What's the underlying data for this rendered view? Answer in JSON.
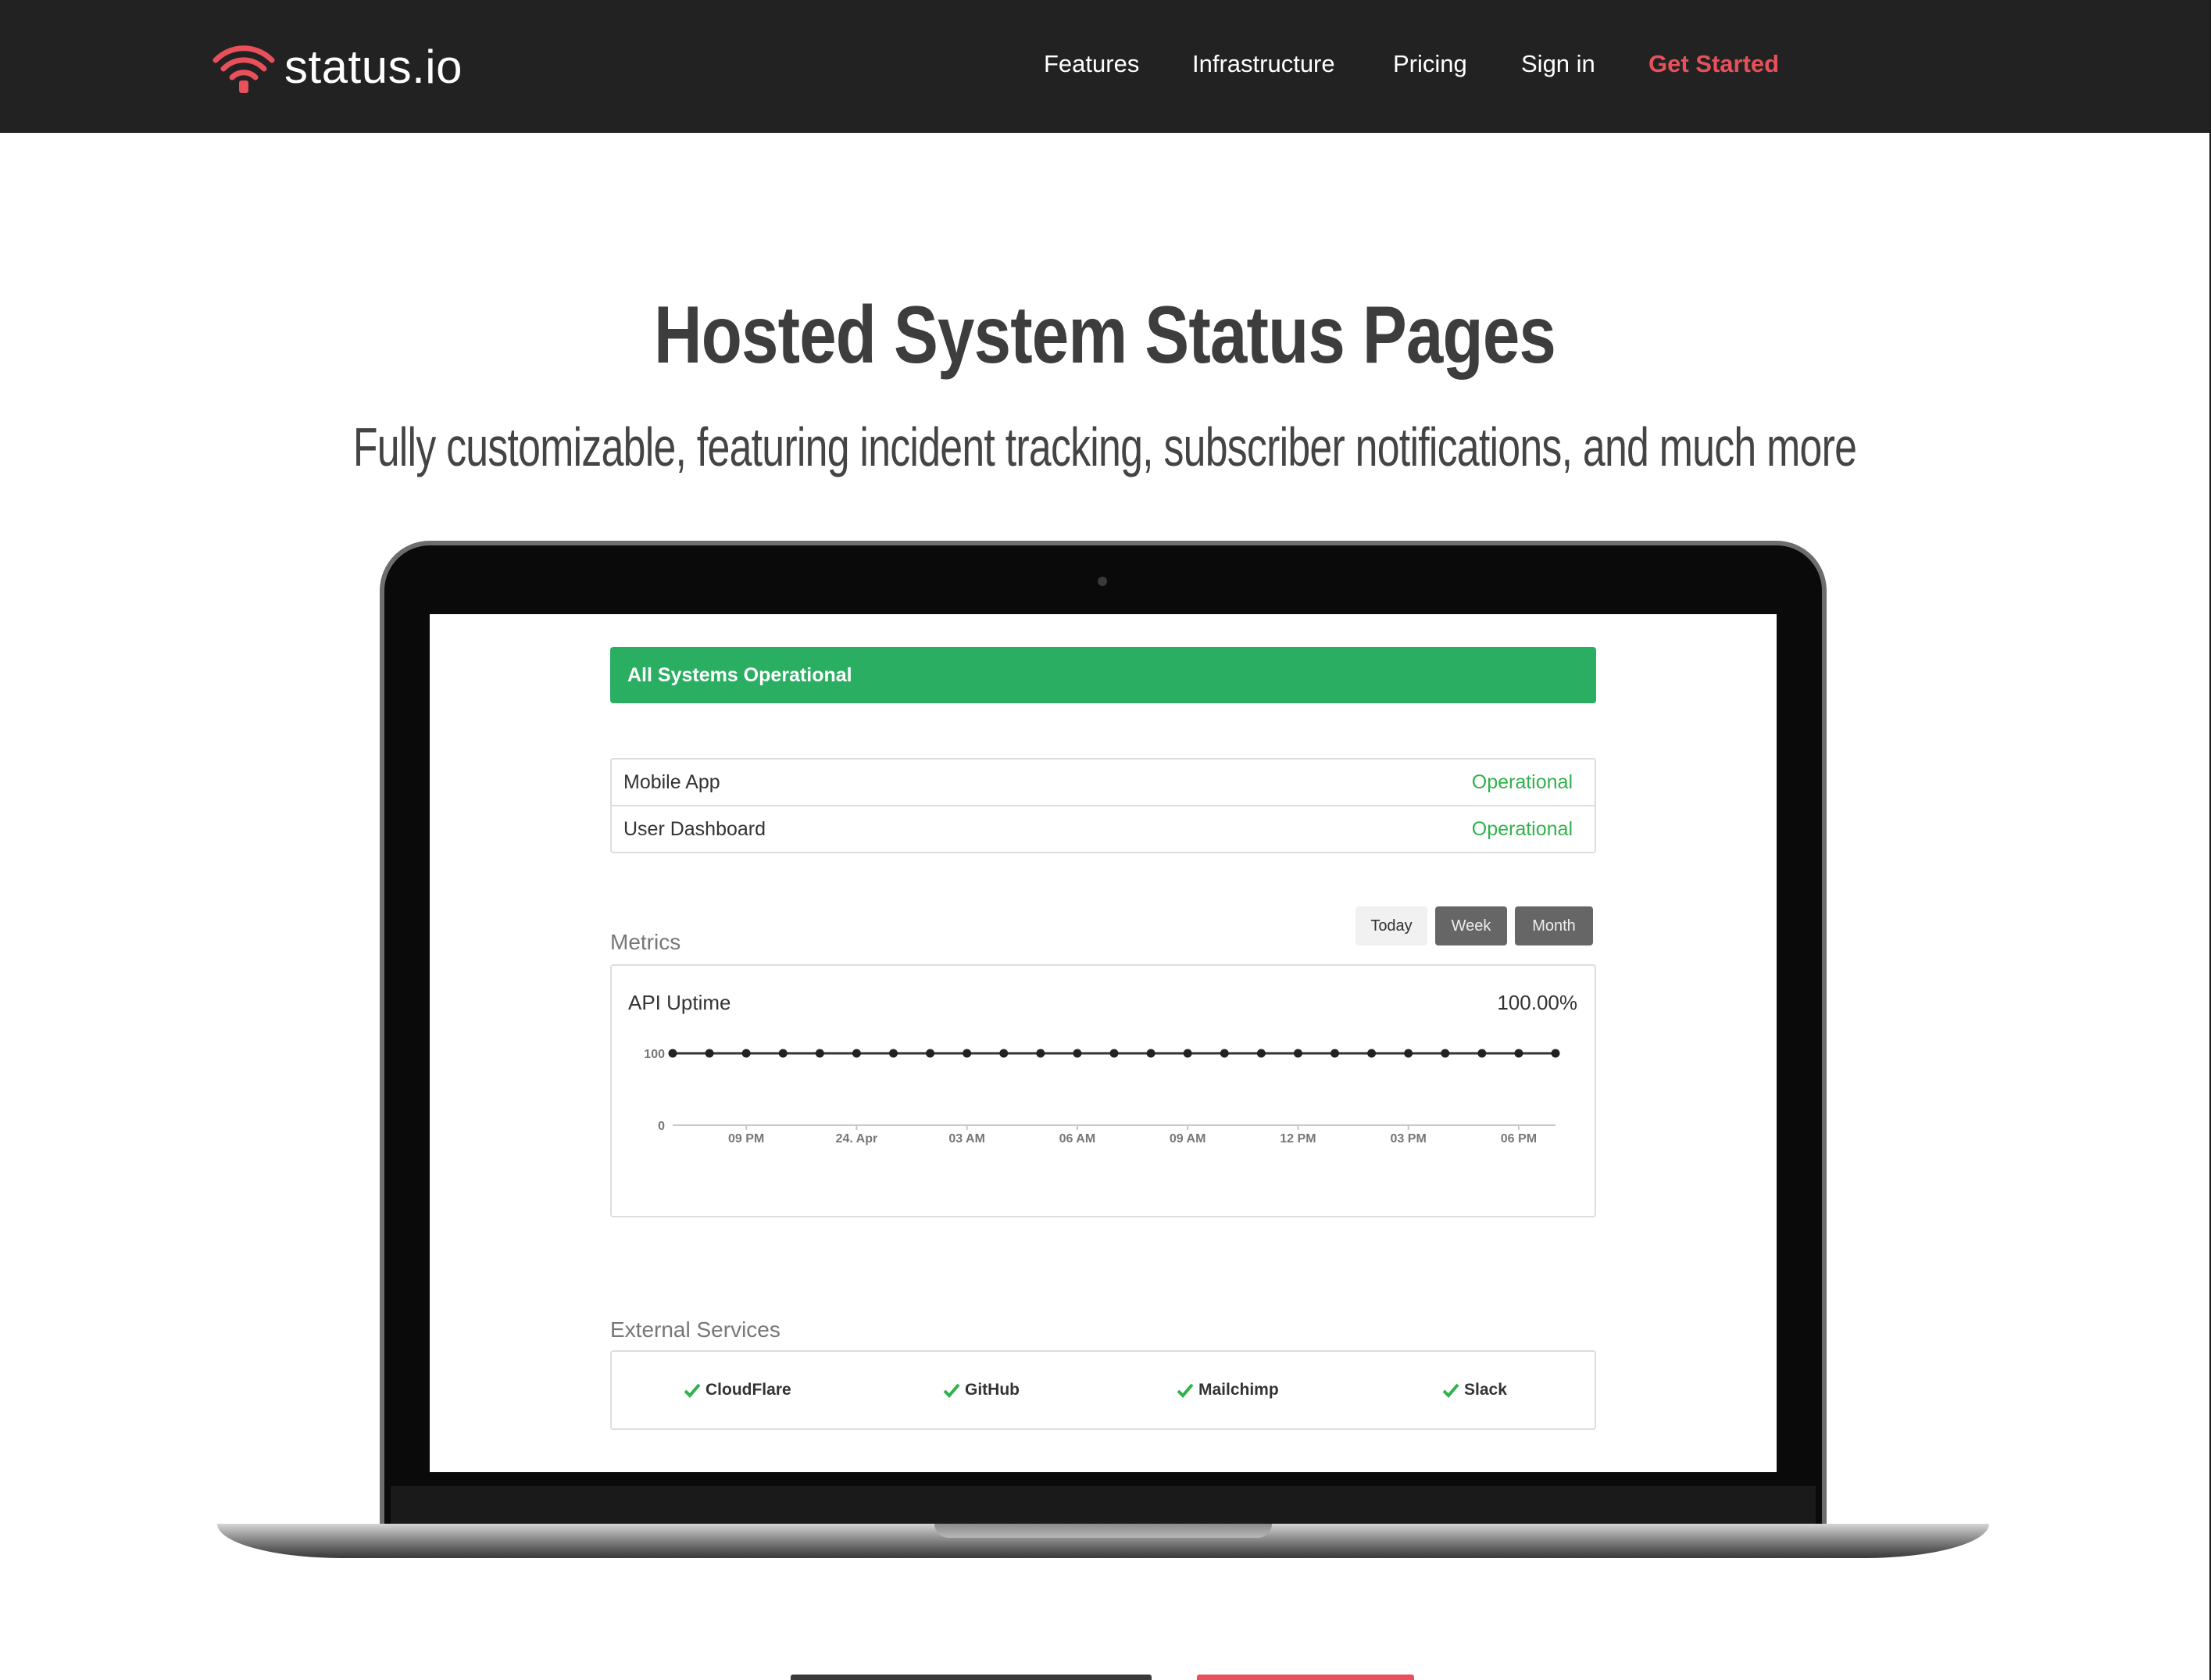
{
  "brand": {
    "name": "status.io",
    "logo_icon": "wifi-signal-icon",
    "accent_color": "#e8505b"
  },
  "nav": {
    "items": [
      {
        "label": "Features"
      },
      {
        "label": "Infrastructure"
      },
      {
        "label": "Pricing"
      },
      {
        "label": "Sign in"
      }
    ],
    "cta": "Get Started"
  },
  "hero": {
    "title": "Hosted System Status Pages",
    "subtitle": "Fully customizable, featuring incident tracking, subscriber notifications, and much more"
  },
  "status_page": {
    "banner": {
      "text": "All Systems Operational",
      "color": "#29ae62"
    },
    "components": [
      {
        "name": "Mobile App",
        "status": "Operational"
      },
      {
        "name": "User Dashboard",
        "status": "Operational"
      }
    ],
    "status_color": "#2fb34a",
    "metrics": {
      "label": "Metrics",
      "ranges": [
        "Today",
        "Week",
        "Month"
      ],
      "chart_title": "API Uptime",
      "chart_value": "100.00%"
    },
    "external_services": {
      "label": "External Services",
      "check_icon": "check-icon",
      "items": [
        "CloudFlare",
        "GitHub",
        "Mailchimp",
        "Slack"
      ]
    }
  },
  "chart_data": {
    "type": "line",
    "title": "API Uptime",
    "xlabel": "",
    "ylabel": "",
    "ylim": [
      0,
      100
    ],
    "y_ticks": [
      "100",
      "0"
    ],
    "x_tick_labels": [
      "09 PM",
      "24. Apr",
      "03 AM",
      "06 AM",
      "09 AM",
      "12 PM",
      "03 PM",
      "06 PM"
    ],
    "series": [
      {
        "values": [
          100,
          100,
          100,
          100,
          100,
          100,
          100,
          100,
          100,
          100,
          100,
          100,
          100,
          100,
          100,
          100,
          100,
          100,
          100,
          100,
          100,
          100,
          100,
          100,
          100
        ]
      }
    ],
    "grid": false
  }
}
